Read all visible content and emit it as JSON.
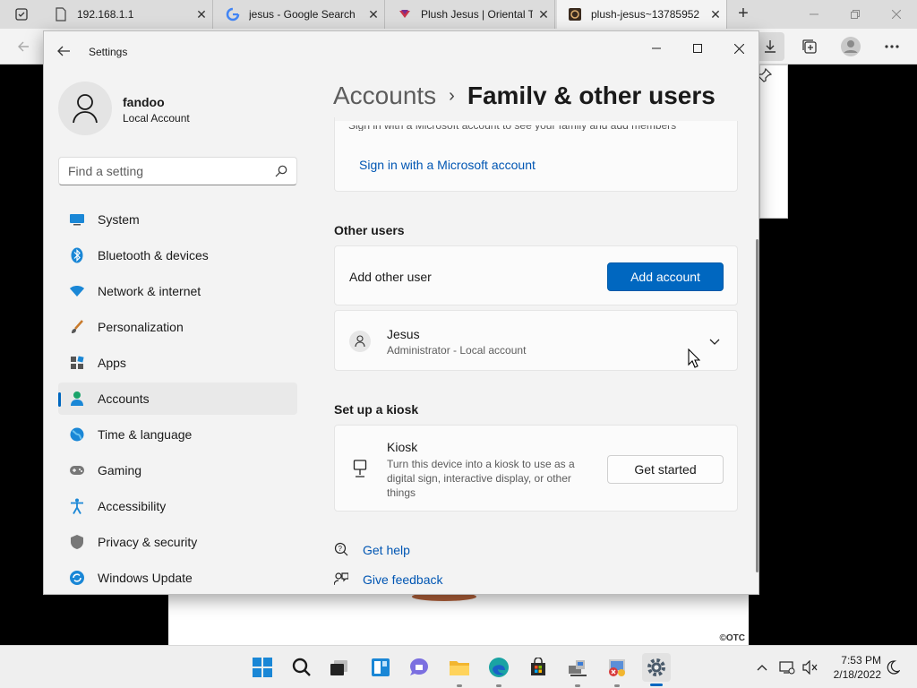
{
  "browser": {
    "tabs": [
      {
        "title": "192.168.1.1",
        "icon": "page-icon"
      },
      {
        "title": "jesus - Google Search",
        "icon": "google-icon"
      },
      {
        "title": "Plush Jesus | Oriental Tr",
        "icon": "oriental-trading-icon"
      },
      {
        "title": "plush-jesus~13785952",
        "icon": "image-icon",
        "active": true
      }
    ],
    "close_glyph": "✕",
    "new_tab_glyph": "+"
  },
  "settings": {
    "window_title": "Settings",
    "profile": {
      "name": "fandoo",
      "account_type": "Local Account"
    },
    "search": {
      "placeholder": "Find a setting"
    },
    "nav": [
      {
        "label": "System",
        "icon": "monitor-icon"
      },
      {
        "label": "Bluetooth & devices",
        "icon": "bluetooth-icon"
      },
      {
        "label": "Network & internet",
        "icon": "wifi-icon"
      },
      {
        "label": "Personalization",
        "icon": "brush-icon"
      },
      {
        "label": "Apps",
        "icon": "apps-icon"
      },
      {
        "label": "Accounts",
        "icon": "person-icon",
        "selected": true
      },
      {
        "label": "Time & language",
        "icon": "globe-icon"
      },
      {
        "label": "Gaming",
        "icon": "gamepad-icon"
      },
      {
        "label": "Accessibility",
        "icon": "accessibility-icon"
      },
      {
        "label": "Privacy & security",
        "icon": "shield-icon"
      },
      {
        "label": "Windows Update",
        "icon": "update-icon"
      }
    ],
    "breadcrumb": {
      "parent": "Accounts",
      "separator": "›",
      "current": "Family & other users"
    },
    "family": {
      "cut_text": "Sign in with a Microsoft account to see your family and add members",
      "link": "Sign in with a Microsoft account"
    },
    "other_users": {
      "heading": "Other users",
      "add_label": "Add other user",
      "add_button": "Add account",
      "user": {
        "name": "Jesus",
        "role": "Administrator - Local account"
      }
    },
    "kiosk": {
      "heading": "Set up a kiosk",
      "title": "Kiosk",
      "description": "Turn this device into a kiosk to use as a digital sign, interactive display, or other things",
      "button": "Get started"
    },
    "help": {
      "get_help": "Get help",
      "feedback": "Give feedback"
    }
  },
  "taskbar": {
    "apps": [
      "start-icon",
      "search-icon",
      "task-view-icon",
      "widgets-icon",
      "chat-icon",
      "file-explorer-icon",
      "edge-icon",
      "store-icon",
      "network-app-icon",
      "remote-app-icon",
      "settings-icon"
    ],
    "time": "7:53 PM",
    "date": "2/18/2022"
  },
  "watermark": "©OTC",
  "colors": {
    "accent": "#0067c0",
    "link": "#0056b3",
    "window_bg": "#f3f3f3",
    "card_bg": "#fbfbfb"
  }
}
